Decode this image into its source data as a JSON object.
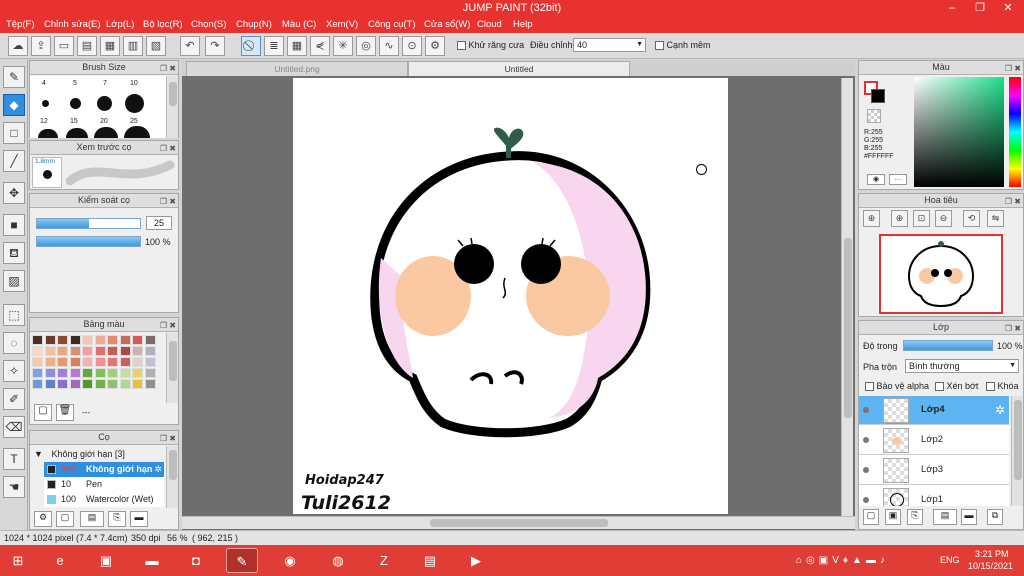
{
  "window": {
    "title": "JUMP PAINT (32bit)",
    "buttons": [
      "–",
      "❐",
      "✕"
    ]
  },
  "menu": [
    "Tệp(F)",
    "Chỉnh sửa(E)",
    "Lớp(L)",
    "Bộ lọc(R)",
    "Chọn(S)",
    "Chụp(N)",
    "Màu (C)",
    "Xem(V)",
    "Công cụ(T)",
    "Cửa sổ(W)",
    "Cloud",
    "Help"
  ],
  "toolbar": {
    "antialias_label": "Khử răng cưa",
    "adjust_label": "Điều chỉnh",
    "adjust_value": "40",
    "smooth_edge_label": "Cạnh mềm"
  },
  "panels": {
    "brush_size": {
      "title": "Brush Size",
      "sizes_row1": [
        "4",
        "5",
        "7",
        "10"
      ],
      "sizes_row2": [
        "12",
        "15",
        "20",
        "25"
      ]
    },
    "brush_preview": {
      "title": "Xem trước cọ",
      "size": "1.8mm"
    },
    "brush_control": {
      "title": "Kiểm soát cọ",
      "size_value": "25",
      "opacity_value": "100 %",
      "size_fraction": 0.5,
      "opacity_fraction": 1.0
    },
    "palette": {
      "title": "Bảng màu",
      "footer": "---",
      "colors": [
        "#4a2e24",
        "#6a3c2c",
        "#8c4a34",
        "#3a2a22",
        "#f6c7b8",
        "#f0a898",
        "#e58a70",
        "#c36a58",
        "#d45a5a",
        "#7a6a6a",
        "#f8d8c0",
        "#f0c0a0",
        "#e8a880",
        "#d89070",
        "#f4a0a0",
        "#e07070",
        "#c85a5a",
        "#a84848",
        "#d0b0b0",
        "#b0b0c0",
        "#f8c8a8",
        "#f0b088",
        "#e89870",
        "#d88058",
        "#f8b0b0",
        "#f09090",
        "#e07878",
        "#c86060",
        "#e0d0d0",
        "#c0c0d0",
        "#80a0e8",
        "#9090d8",
        "#a080d8",
        "#b878d0",
        "#60a840",
        "#80c060",
        "#a0d080",
        "#c0e0a0",
        "#f0d060",
        "#b0b0b0",
        "#7098e0",
        "#6080c8",
        "#8870c8",
        "#a068c0",
        "#509830",
        "#70b050",
        "#90c070",
        "#b0d890",
        "#e8c040",
        "#909090"
      ]
    },
    "brushes": {
      "title": "Cọ",
      "group": "Không giới hạn [3]",
      "items": [
        {
          "size": "300",
          "name": "Không giới hạn"
        },
        {
          "size": "10",
          "name": "Pen"
        },
        {
          "size": "100",
          "name": "Watercolor (Wet)"
        }
      ]
    },
    "color": {
      "title": "Màu",
      "r": "R:255",
      "g": "G:255",
      "b": "B:255",
      "hex": "#FFFFFF"
    },
    "navigator": {
      "title": "Hoa tiêu"
    },
    "layers": {
      "title": "Lớp",
      "opacity_label": "Độ trong",
      "opacity_value": "100 %",
      "opacity_fraction": 1.0,
      "blend_label": "Pha trộn",
      "blend_value": "Bình thường",
      "protect_alpha": "Bảo vệ alpha",
      "clipping": "Xén bớt",
      "lock": "Khóa",
      "items": [
        {
          "name": "Lớp4",
          "selected": true
        },
        {
          "name": "Lớp2",
          "selected": false
        },
        {
          "name": "Lớp3",
          "selected": false
        },
        {
          "name": "Lớp1",
          "selected": false
        }
      ]
    }
  },
  "tabs": [
    "Untitled.png",
    "Untitled"
  ],
  "canvas": {
    "handwriting_line1": "Hoidap247",
    "handwriting_line2": "Tuli2612"
  },
  "status": {
    "pixel_size": "1024 * 1024 pixel",
    "cm_size": "(7.4 * 7.4cm)",
    "dpi": "350 dpi",
    "zoom": "56 %",
    "cursor": "( 962, 215 )"
  },
  "taskbar": {
    "language": "ENG",
    "time": "3:21 PM",
    "date": "10/15/2021"
  }
}
